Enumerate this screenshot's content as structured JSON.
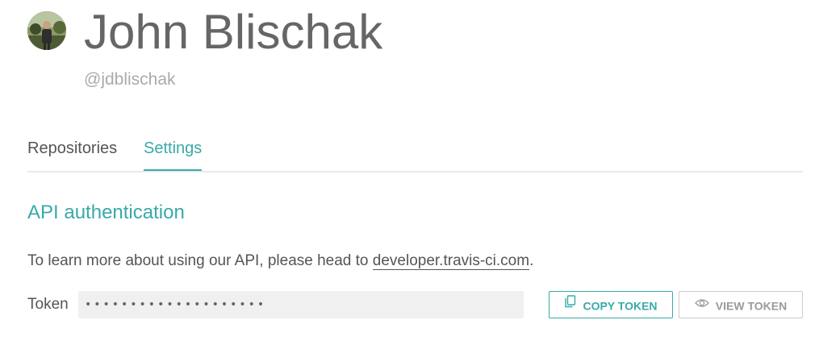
{
  "profile": {
    "name": "John Blischak",
    "handle": "@jdblischak",
    "avatar_icon": "user-avatar-photo"
  },
  "tabs": [
    {
      "label": "Repositories",
      "active": false
    },
    {
      "label": "Settings",
      "active": true
    }
  ],
  "api": {
    "title": "API authentication",
    "description_prefix": "To learn more about using our API, please head to ",
    "link_text": "developer.travis-ci.com",
    "description_suffix": ".",
    "token_label": "Token",
    "token_masked": "••••••••••••••••••••",
    "copy_button": {
      "label": "COPY TOKEN",
      "icon": "copy-icon"
    },
    "view_button": {
      "label": "VIEW TOKEN",
      "icon": "eye-icon"
    }
  },
  "colors": {
    "accent": "#39a9a9",
    "text": "#555555",
    "muted": "#aaaaaa",
    "field_bg": "#f0f0f0"
  }
}
